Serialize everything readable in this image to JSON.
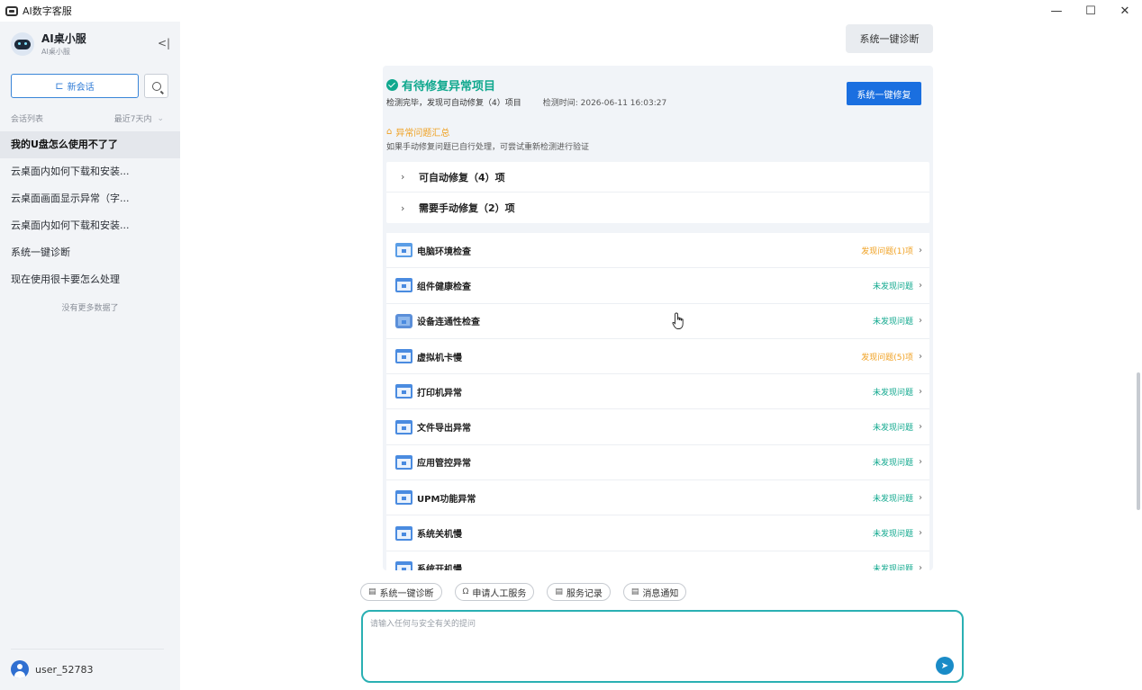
{
  "window": {
    "title": "AI数字客服"
  },
  "sidebar": {
    "brand_name": "AI桌小服",
    "brand_sub": "AI桌小服",
    "new_chat_label": "新会话",
    "list_title": "会话列表",
    "list_filter": "最近7天内",
    "conversations": [
      {
        "label": "我的U盘怎么使用不了了"
      },
      {
        "label": "云桌面内如何下载和安装..."
      },
      {
        "label": "云桌面画面显示异常（字..."
      },
      {
        "label": "云桌面内如何下载和安装..."
      },
      {
        "label": "系统一键诊断"
      },
      {
        "label": "现在使用很卡要怎么处理"
      }
    ],
    "no_more": "没有更多数据了",
    "user_name": "user_52783"
  },
  "main": {
    "diag_button": "系统一键诊断",
    "panel": {
      "title": "有待修复异常项目",
      "subtitle": "检测完毕，发现可自动修复（4）项目",
      "time": "检测时间: 2026-06-11 16:03:27",
      "fix_button": "系统一键修复",
      "warn_title": "异常问题汇总",
      "warn_sub": "如果手动修复问题已自行处理，可尝试重新检测进行验证",
      "groups": [
        {
          "label": "可自动修复（4）项"
        },
        {
          "label": "需要手动修复（2）项"
        }
      ],
      "checks": [
        {
          "name": "电脑环境检查",
          "status": "发现问题(1)项",
          "icon": "monitor-icon"
        },
        {
          "name": "组件健康检查",
          "status": "未发现问题",
          "icon": "window-icon"
        },
        {
          "name": "设备连通性检查",
          "status": "未发现问题",
          "icon": "cube-icon"
        },
        {
          "name": "虚拟机卡慢",
          "status": "发现问题(5)项",
          "icon": "window-icon"
        },
        {
          "name": "打印机异常",
          "status": "未发现问题",
          "icon": "window-icon"
        },
        {
          "name": "文件导出异常",
          "status": "未发现问题",
          "icon": "window-icon"
        },
        {
          "name": "应用管控异常",
          "status": "未发现问题",
          "icon": "window-icon"
        },
        {
          "name": "UPM功能异常",
          "status": "未发现问题",
          "icon": "window-icon"
        },
        {
          "name": "系统关机慢",
          "status": "未发现问题",
          "icon": "window-icon"
        },
        {
          "name": "系统开机慢",
          "status": "未发现问题",
          "icon": "window-icon"
        }
      ]
    },
    "quick_actions": [
      {
        "label": "系统一键诊断",
        "icon": "doc-icon"
      },
      {
        "label": "申请人工服务",
        "icon": "headset-icon"
      },
      {
        "label": "服务记录",
        "icon": "doc-icon"
      },
      {
        "label": "消息通知",
        "icon": "doc-icon"
      }
    ],
    "input_placeholder": "请输入任何与安全有关的提问"
  },
  "colors": {
    "accent": "#1a6fe0",
    "ok": "#10a88e",
    "warn": "#f0a020",
    "input_border": "#2ab0b3"
  }
}
